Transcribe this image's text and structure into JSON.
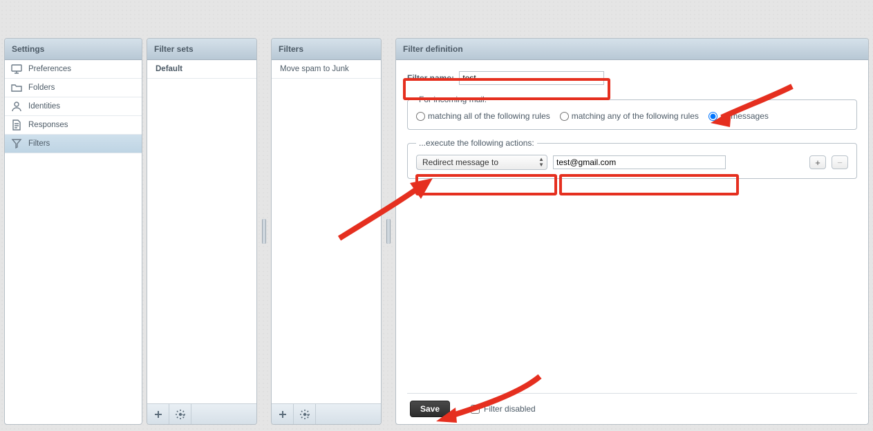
{
  "settings": {
    "title": "Settings",
    "items": [
      {
        "label": "Preferences",
        "icon": "monitor"
      },
      {
        "label": "Folders",
        "icon": "folder"
      },
      {
        "label": "Identities",
        "icon": "user"
      },
      {
        "label": "Responses",
        "icon": "doc"
      },
      {
        "label": "Filters",
        "icon": "filter",
        "selected": true
      }
    ]
  },
  "filtersets": {
    "title": "Filter sets",
    "items": [
      {
        "label": "Default",
        "bold": true
      }
    ]
  },
  "filters": {
    "title": "Filters",
    "items": [
      {
        "label": "Move spam to Junk"
      }
    ]
  },
  "definition": {
    "title": "Filter definition",
    "name_label": "Filter name:",
    "name_value": "test",
    "incoming_legend": "For incoming mail:",
    "radio_all_rules": "matching all of the following rules",
    "radio_any_rules": "matching any of the following rules",
    "radio_all_msgs": "all messages",
    "radio_selected": "all_messages",
    "actions_legend": "...execute the following actions:",
    "action_select": "Redirect message to",
    "action_value": "test@gmail.com",
    "save_label": "Save",
    "disabled_label": "Filter disabled",
    "disabled_checked": false,
    "plus": "+",
    "minus": "−"
  }
}
